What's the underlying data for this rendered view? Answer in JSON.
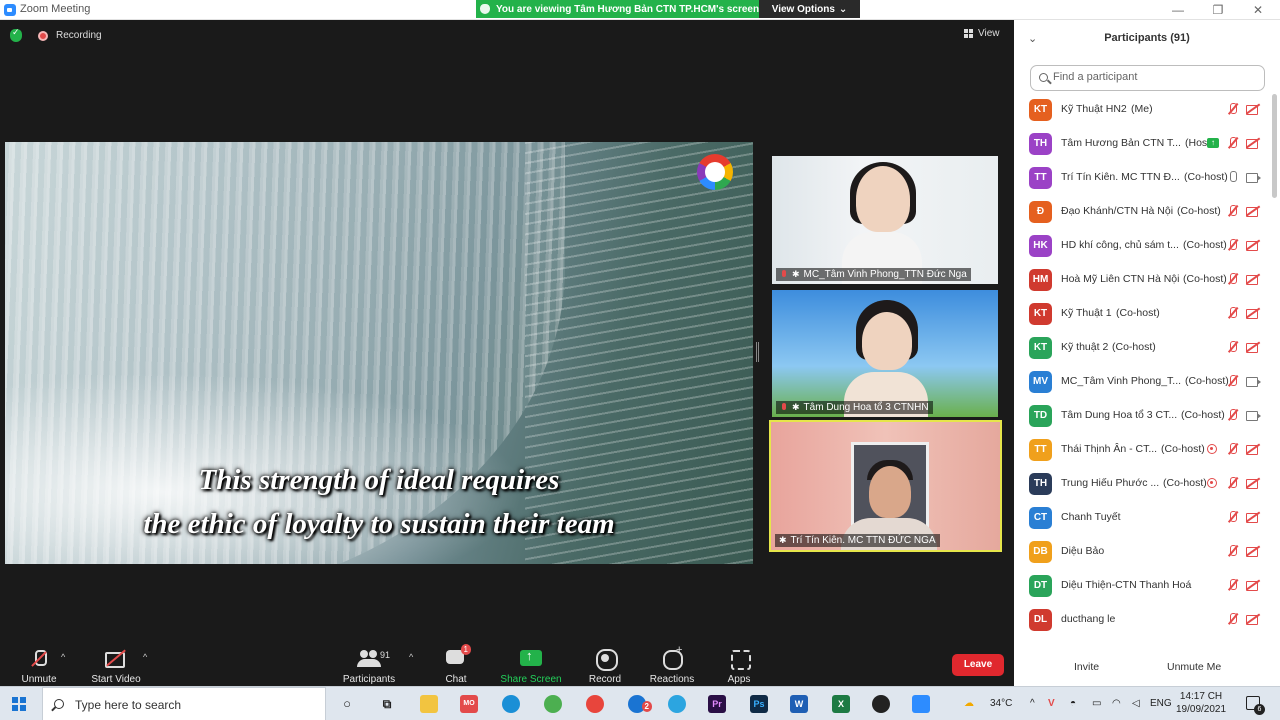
{
  "window": {
    "title": "Zoom Meeting",
    "share_banner": "You are viewing Tâm Hương Bản CTN TP.HCM's screen",
    "view_options": "View Options"
  },
  "meeting": {
    "recording_label": "Recording",
    "view_label": "View",
    "subtitle_line1": "This strength of ideal requires",
    "subtitle_line2": "the ethic of loyalty to sustain their team",
    "videos": [
      {
        "name": "MC_Tâm Vinh Phong_TTN Đức Nga"
      },
      {
        "name": "Tâm Dung Hoa tổ 3 CTNHN"
      },
      {
        "name": "Trí Tín Kiên. MC  TTN ĐỨC NGA"
      }
    ]
  },
  "toolbar": {
    "unmute": "Unmute",
    "start_video": "Start Video",
    "participants": "Participants",
    "participants_count": "91",
    "chat": "Chat",
    "chat_badge": "1",
    "share_screen": "Share Screen",
    "record": "Record",
    "reactions": "Reactions",
    "apps": "Apps",
    "leave": "Leave",
    "caret": "^",
    "share_color": "#23b24a",
    "leave_color": "#e0282e"
  },
  "panel": {
    "title": "Participants (91)",
    "search_placeholder": "Find a participant",
    "invite": "Invite",
    "unmute_me": "Unmute Me",
    "participants": [
      {
        "initials": "KT",
        "color": "#e5601f",
        "name": "Kỹ Thuật HN2",
        "role": "(Me)",
        "mic": "muted",
        "cam": "off"
      },
      {
        "initials": "TH",
        "color": "#9b42c6",
        "name": "Tâm Hương Bản CTN T...",
        "role": "(Host)",
        "share": true,
        "mic": "muted",
        "cam": "off"
      },
      {
        "initials": "TT",
        "color": "#9b42c6",
        "name": "Trí Tín Kiên. MC  TTN Đ...",
        "role": "(Co-host)",
        "mic": "on",
        "cam": "on"
      },
      {
        "initials": "Đ",
        "color": "#e5601f",
        "name": "Đạo Khánh/CTN Hà Nội",
        "role": "(Co-host)",
        "mic": "muted",
        "cam": "off"
      },
      {
        "initials": "HK",
        "color": "#9b42c6",
        "name": "HD khí công, chủ sám t...",
        "role": "(Co-host)",
        "mic": "muted",
        "cam": "off"
      },
      {
        "initials": "HM",
        "color": "#d03a2f",
        "name": "Hoà Mỹ Liên CTN Hà Nội",
        "role": "(Co-host)",
        "mic": "muted",
        "cam": "off"
      },
      {
        "initials": "KT",
        "color": "#d03a2f",
        "name": "Kỹ Thuật 1",
        "role": "(Co-host)",
        "mic": "muted",
        "cam": "off"
      },
      {
        "initials": "KT",
        "color": "#2aa45a",
        "name": "Kỹ thuật 2",
        "role": "(Co-host)",
        "mic": "muted",
        "cam": "off"
      },
      {
        "initials": "MV",
        "color": "#2a7fd4",
        "name": "MC_Tâm Vinh Phong_T...",
        "role": "(Co-host)",
        "mic": "muted",
        "cam": "on"
      },
      {
        "initials": "TD",
        "color": "#2aa45a",
        "name": "Tâm Dung Hoa tổ 3 CT...",
        "role": "(Co-host)",
        "mic": "muted",
        "cam": "on"
      },
      {
        "initials": "TT",
        "color": "#f0a01c",
        "name": "Thái Thịnh Ân - CT...",
        "role": "(Co-host)",
        "rec": true,
        "mic": "muted",
        "cam": "off"
      },
      {
        "initials": "TH",
        "color": "#2b3c5a",
        "name": "Trung Hiếu Phước ...",
        "role": "(Co-host)",
        "rec": true,
        "mic": "muted",
        "cam": "off"
      },
      {
        "initials": "CT",
        "color": "#2a7fd4",
        "name": "Chanh Tuyết",
        "role": "",
        "mic": "muted",
        "cam": "off"
      },
      {
        "initials": "DB",
        "color": "#f0a01c",
        "name": "Diệu Bảo",
        "role": "",
        "mic": "muted",
        "cam": "off"
      },
      {
        "initials": "DT",
        "color": "#2aa45a",
        "name": "Diệu Thiện-CTN Thanh Hoá",
        "role": "",
        "mic": "muted",
        "cam": "off"
      },
      {
        "initials": "DL",
        "color": "#d03a2f",
        "name": "ducthang le",
        "role": "",
        "mic": "muted",
        "cam": "off"
      }
    ]
  },
  "taskbar": {
    "search_placeholder": "Type here to search",
    "temperature": "34°C",
    "language": "ENG",
    "time": "14:17 CH",
    "date": "19/09/2021",
    "notifications": "6",
    "zalo_badge": "2"
  }
}
